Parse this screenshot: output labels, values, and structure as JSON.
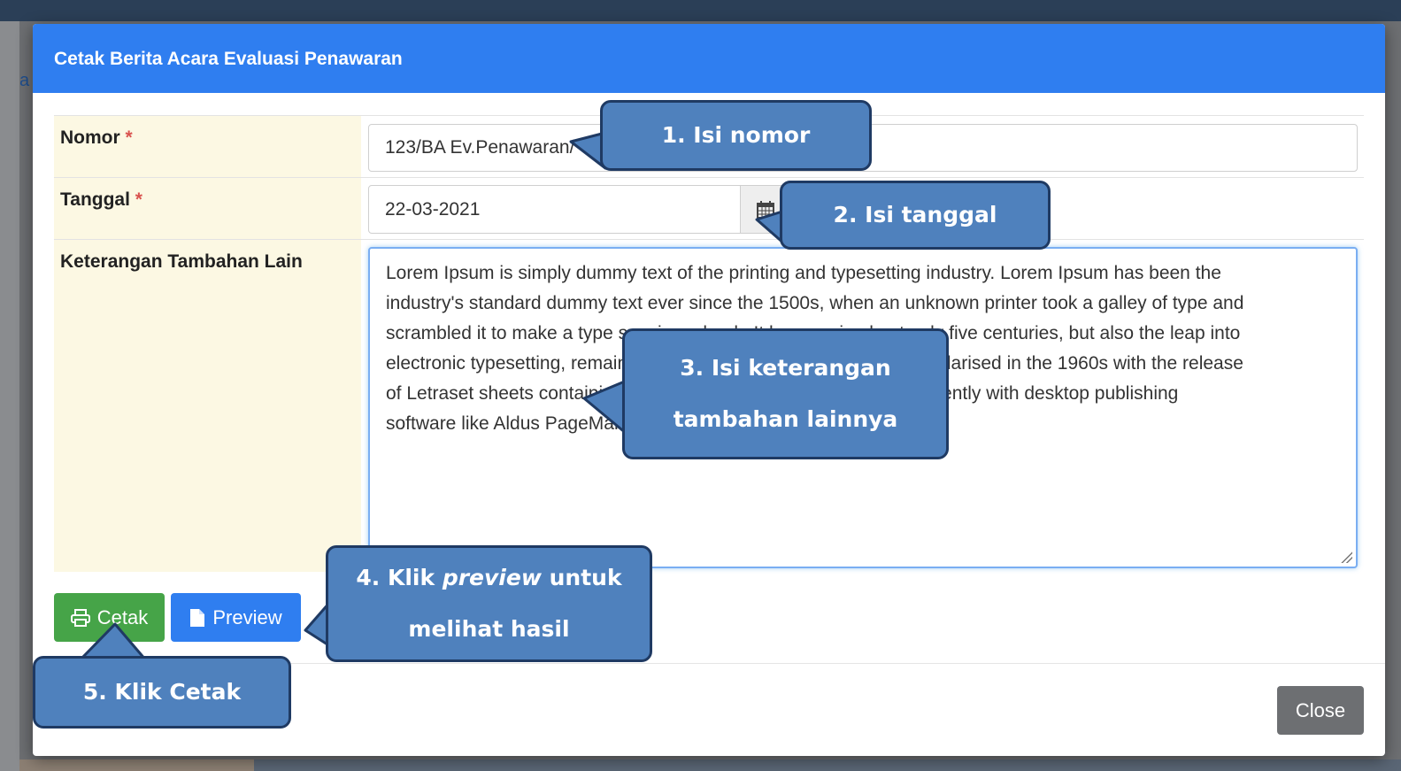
{
  "background": {
    "letter": "a"
  },
  "modal": {
    "title": "Cetak Berita Acara Evaluasi Penawaran",
    "fields": {
      "nomor": {
        "label": "Nomor",
        "required_mark": "*",
        "value": "123/BA Ev.Penawaran/"
      },
      "tanggal": {
        "label": "Tanggal",
        "required_mark": "*",
        "value": "22-03-2021",
        "addon_icon": "calendar-icon"
      },
      "keterangan": {
        "label": "Keterangan Tambahan Lain",
        "lines": [
          "Lorem Ipsum is simply dummy text of the printing and typesetting industry. Lorem Ipsum has been the",
          "industry's standard dummy text ever since the 1500s, when an unknown printer took a galley of type and",
          "scrambled it to make a type specimen book. It has survived not only five centuries, but also the leap into",
          "electronic typesetting, remaining essentially unchanged. It was popularised in the 1960s with the release",
          "of Letraset sheets containing Lorem Ipsum passages, and more recently with desktop publishing",
          "software like Aldus PageMaker including versions of Lorem Ipsum."
        ]
      }
    },
    "buttons": {
      "cetak": {
        "label": "Cetak",
        "icon": "printer-icon",
        "color": "#46a448"
      },
      "preview": {
        "label": "Preview",
        "icon": "file-icon",
        "color": "#2f7ef0"
      },
      "close": {
        "label": "Close",
        "color": "#6d6f72"
      }
    },
    "header_color": "#2f7ef0"
  },
  "callouts": {
    "step1": "1. Isi nomor",
    "step2": "2. Isi tanggal",
    "step3_line1": "3. Isi keterangan",
    "step3_line2": "tambahan lainnya",
    "step4_prefix": "4. Klik ",
    "step4_italic": "preview",
    "step4_suffix": " untuk",
    "step4_line2": "melihat hasil",
    "step5": "5. Klik Cetak",
    "fill_color": "#4f81bd",
    "border_color": "#1f3a63"
  }
}
